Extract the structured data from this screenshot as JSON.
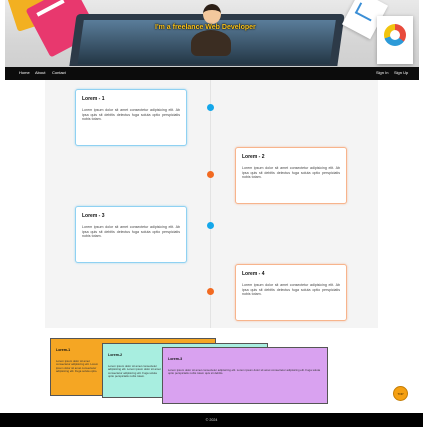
{
  "hero": {
    "tagline": "I'm a freelance Web Developer"
  },
  "nav": {
    "home": "Home",
    "about": "About",
    "contact": "Contact",
    "sign_in": "Sign In",
    "sign_up": "Sign Up"
  },
  "colors": {
    "accent_blue": "#14a7ea",
    "accent_orange": "#f26a21",
    "card_yellow": "#f5a623",
    "card_teal": "#a8eee0",
    "card_violet": "#d9a2f0"
  },
  "timeline": {
    "items": [
      {
        "title": "Lorem - 1",
        "text": "Lorem ipsum dolor sit amet consectetur adipisicing elit. Ab ipsa quis sit debitis delectus fuga soluta optio perspiciatis nobis totam."
      },
      {
        "title": "Lorem - 2",
        "text": "Lorem ipsum dolor sit amet consectetur adipisicing elit. Ab ipsa quis sit debitis delectus fuga soluta optio perspiciatis nobis totam."
      },
      {
        "title": "Lorem - 3",
        "text": "Lorem ipsum dolor sit amet consectetur adipisicing elit. Ab ipsa quis sit debitis delectus fuga soluta optio perspiciatis nobis totam."
      },
      {
        "title": "Lorem - 4",
        "text": "Lorem ipsum dolor sit amet consectetur adipisicing elit. Ab ipsa quis sit debitis delectus fuga soluta optio perspiciatis nobis totam."
      }
    ]
  },
  "stack_cards": [
    {
      "title": "Lorem-1",
      "text": "Lorem ipsum dolor sit amet consectetur adipisicing elit. Lorem ipsum dolor sit amet consectetur adipisicing elit. Fuga soluta optio."
    },
    {
      "title": "Lorem-2",
      "text": "Lorem ipsum dolor sit amet consectetur adipisicing elit. Lorem ipsum dolor sit amet consectetur adipisicing elit. Fuga soluta optio perspiciatis nobis totam."
    },
    {
      "title": "Lorem-3",
      "text": "Lorem ipsum dolor sit amet consectetur adipisicing elit. Lorem ipsum dolor sit amet consectetur adipisicing elit. Fuga soluta optio perspiciatis nobis totam quis sit debitis."
    }
  ],
  "scroll_top": {
    "label": "TOP"
  },
  "footer": {
    "text": "© 2024"
  }
}
